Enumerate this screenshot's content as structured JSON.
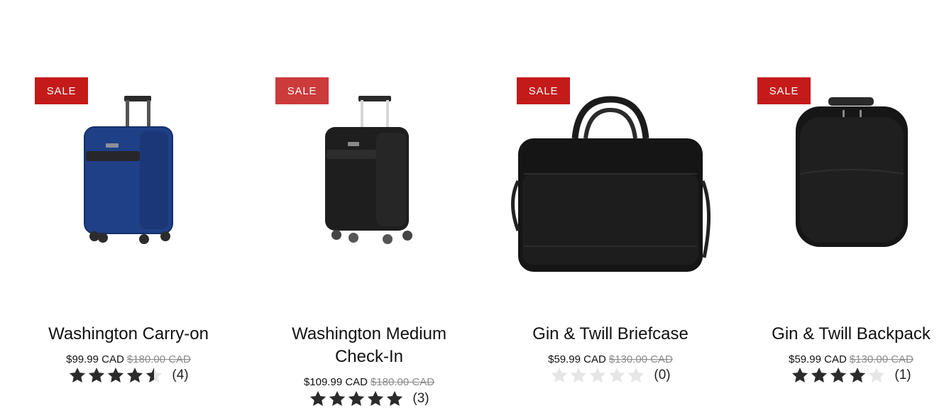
{
  "products": [
    {
      "badge": "SALE",
      "title": "Washington Carry-on",
      "price_now": "$99.99 CAD",
      "price_was": "$180.00 CAD",
      "rating": 4.5,
      "review_count": "(4)",
      "image": "navy-carry-on-suitcase"
    },
    {
      "badge": "SALE",
      "title_line1": "Washington Medium",
      "title_line2": "Check-In",
      "price_now": "$109.99 CAD",
      "price_was": "$180.00 CAD",
      "rating": 5,
      "review_count": "(3)",
      "image": "black-check-in-suitcase"
    },
    {
      "badge": "SALE",
      "title": "Gin & Twill Briefcase",
      "price_now": "$59.99 CAD",
      "price_was": "$130.00 CAD",
      "rating": 0,
      "review_count": "(0)",
      "image": "black-leather-briefcase"
    },
    {
      "badge": "SALE",
      "title": "Gin & Twill Backpack",
      "price_now": "$59.99 CAD",
      "price_was": "$130.00 CAD",
      "rating": 4,
      "review_count": "(1)",
      "image": "black-leather-backpack"
    }
  ],
  "colors": {
    "sale_badge": "#c41a1a",
    "star_filled": "#2b2b2b",
    "star_empty": "#e6e6e6",
    "price_was": "#8a8a8a"
  }
}
